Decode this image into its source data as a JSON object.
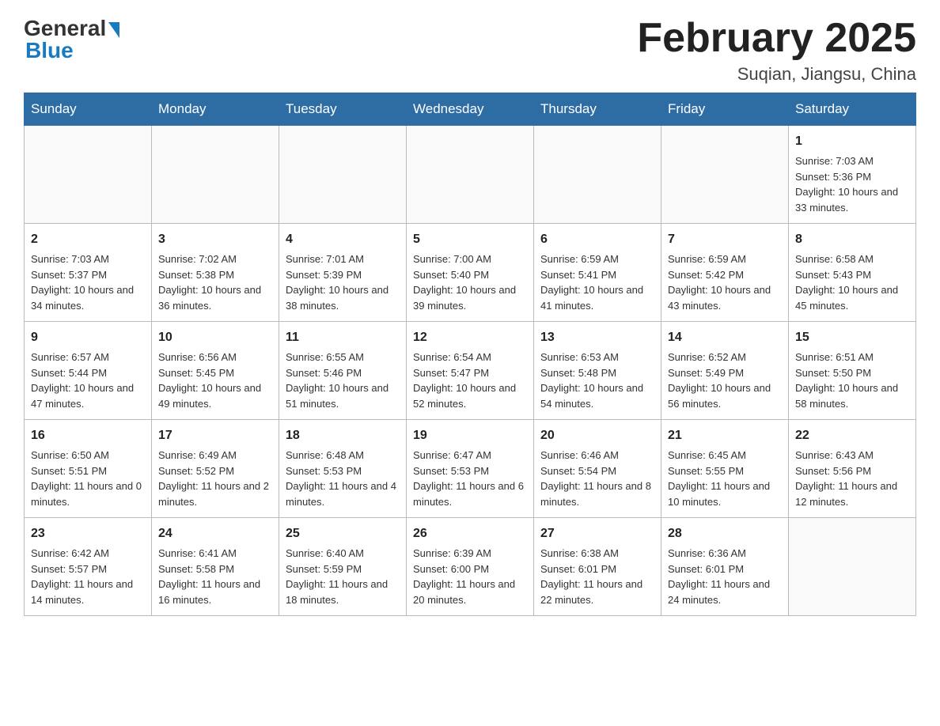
{
  "header": {
    "logo_general": "General",
    "logo_blue": "Blue",
    "month_title": "February 2025",
    "location": "Suqian, Jiangsu, China"
  },
  "days_of_week": [
    "Sunday",
    "Monday",
    "Tuesday",
    "Wednesday",
    "Thursday",
    "Friday",
    "Saturday"
  ],
  "weeks": [
    [
      {
        "day": "",
        "sunrise": "",
        "sunset": "",
        "daylight": ""
      },
      {
        "day": "",
        "sunrise": "",
        "sunset": "",
        "daylight": ""
      },
      {
        "day": "",
        "sunrise": "",
        "sunset": "",
        "daylight": ""
      },
      {
        "day": "",
        "sunrise": "",
        "sunset": "",
        "daylight": ""
      },
      {
        "day": "",
        "sunrise": "",
        "sunset": "",
        "daylight": ""
      },
      {
        "day": "",
        "sunrise": "",
        "sunset": "",
        "daylight": ""
      },
      {
        "day": "1",
        "sunrise": "Sunrise: 7:03 AM",
        "sunset": "Sunset: 5:36 PM",
        "daylight": "Daylight: 10 hours and 33 minutes."
      }
    ],
    [
      {
        "day": "2",
        "sunrise": "Sunrise: 7:03 AM",
        "sunset": "Sunset: 5:37 PM",
        "daylight": "Daylight: 10 hours and 34 minutes."
      },
      {
        "day": "3",
        "sunrise": "Sunrise: 7:02 AM",
        "sunset": "Sunset: 5:38 PM",
        "daylight": "Daylight: 10 hours and 36 minutes."
      },
      {
        "day": "4",
        "sunrise": "Sunrise: 7:01 AM",
        "sunset": "Sunset: 5:39 PM",
        "daylight": "Daylight: 10 hours and 38 minutes."
      },
      {
        "day": "5",
        "sunrise": "Sunrise: 7:00 AM",
        "sunset": "Sunset: 5:40 PM",
        "daylight": "Daylight: 10 hours and 39 minutes."
      },
      {
        "day": "6",
        "sunrise": "Sunrise: 6:59 AM",
        "sunset": "Sunset: 5:41 PM",
        "daylight": "Daylight: 10 hours and 41 minutes."
      },
      {
        "day": "7",
        "sunrise": "Sunrise: 6:59 AM",
        "sunset": "Sunset: 5:42 PM",
        "daylight": "Daylight: 10 hours and 43 minutes."
      },
      {
        "day": "8",
        "sunrise": "Sunrise: 6:58 AM",
        "sunset": "Sunset: 5:43 PM",
        "daylight": "Daylight: 10 hours and 45 minutes."
      }
    ],
    [
      {
        "day": "9",
        "sunrise": "Sunrise: 6:57 AM",
        "sunset": "Sunset: 5:44 PM",
        "daylight": "Daylight: 10 hours and 47 minutes."
      },
      {
        "day": "10",
        "sunrise": "Sunrise: 6:56 AM",
        "sunset": "Sunset: 5:45 PM",
        "daylight": "Daylight: 10 hours and 49 minutes."
      },
      {
        "day": "11",
        "sunrise": "Sunrise: 6:55 AM",
        "sunset": "Sunset: 5:46 PM",
        "daylight": "Daylight: 10 hours and 51 minutes."
      },
      {
        "day": "12",
        "sunrise": "Sunrise: 6:54 AM",
        "sunset": "Sunset: 5:47 PM",
        "daylight": "Daylight: 10 hours and 52 minutes."
      },
      {
        "day": "13",
        "sunrise": "Sunrise: 6:53 AM",
        "sunset": "Sunset: 5:48 PM",
        "daylight": "Daylight: 10 hours and 54 minutes."
      },
      {
        "day": "14",
        "sunrise": "Sunrise: 6:52 AM",
        "sunset": "Sunset: 5:49 PM",
        "daylight": "Daylight: 10 hours and 56 minutes."
      },
      {
        "day": "15",
        "sunrise": "Sunrise: 6:51 AM",
        "sunset": "Sunset: 5:50 PM",
        "daylight": "Daylight: 10 hours and 58 minutes."
      }
    ],
    [
      {
        "day": "16",
        "sunrise": "Sunrise: 6:50 AM",
        "sunset": "Sunset: 5:51 PM",
        "daylight": "Daylight: 11 hours and 0 minutes."
      },
      {
        "day": "17",
        "sunrise": "Sunrise: 6:49 AM",
        "sunset": "Sunset: 5:52 PM",
        "daylight": "Daylight: 11 hours and 2 minutes."
      },
      {
        "day": "18",
        "sunrise": "Sunrise: 6:48 AM",
        "sunset": "Sunset: 5:53 PM",
        "daylight": "Daylight: 11 hours and 4 minutes."
      },
      {
        "day": "19",
        "sunrise": "Sunrise: 6:47 AM",
        "sunset": "Sunset: 5:53 PM",
        "daylight": "Daylight: 11 hours and 6 minutes."
      },
      {
        "day": "20",
        "sunrise": "Sunrise: 6:46 AM",
        "sunset": "Sunset: 5:54 PM",
        "daylight": "Daylight: 11 hours and 8 minutes."
      },
      {
        "day": "21",
        "sunrise": "Sunrise: 6:45 AM",
        "sunset": "Sunset: 5:55 PM",
        "daylight": "Daylight: 11 hours and 10 minutes."
      },
      {
        "day": "22",
        "sunrise": "Sunrise: 6:43 AM",
        "sunset": "Sunset: 5:56 PM",
        "daylight": "Daylight: 11 hours and 12 minutes."
      }
    ],
    [
      {
        "day": "23",
        "sunrise": "Sunrise: 6:42 AM",
        "sunset": "Sunset: 5:57 PM",
        "daylight": "Daylight: 11 hours and 14 minutes."
      },
      {
        "day": "24",
        "sunrise": "Sunrise: 6:41 AM",
        "sunset": "Sunset: 5:58 PM",
        "daylight": "Daylight: 11 hours and 16 minutes."
      },
      {
        "day": "25",
        "sunrise": "Sunrise: 6:40 AM",
        "sunset": "Sunset: 5:59 PM",
        "daylight": "Daylight: 11 hours and 18 minutes."
      },
      {
        "day": "26",
        "sunrise": "Sunrise: 6:39 AM",
        "sunset": "Sunset: 6:00 PM",
        "daylight": "Daylight: 11 hours and 20 minutes."
      },
      {
        "day": "27",
        "sunrise": "Sunrise: 6:38 AM",
        "sunset": "Sunset: 6:01 PM",
        "daylight": "Daylight: 11 hours and 22 minutes."
      },
      {
        "day": "28",
        "sunrise": "Sunrise: 6:36 AM",
        "sunset": "Sunset: 6:01 PM",
        "daylight": "Daylight: 11 hours and 24 minutes."
      },
      {
        "day": "",
        "sunrise": "",
        "sunset": "",
        "daylight": ""
      }
    ]
  ]
}
